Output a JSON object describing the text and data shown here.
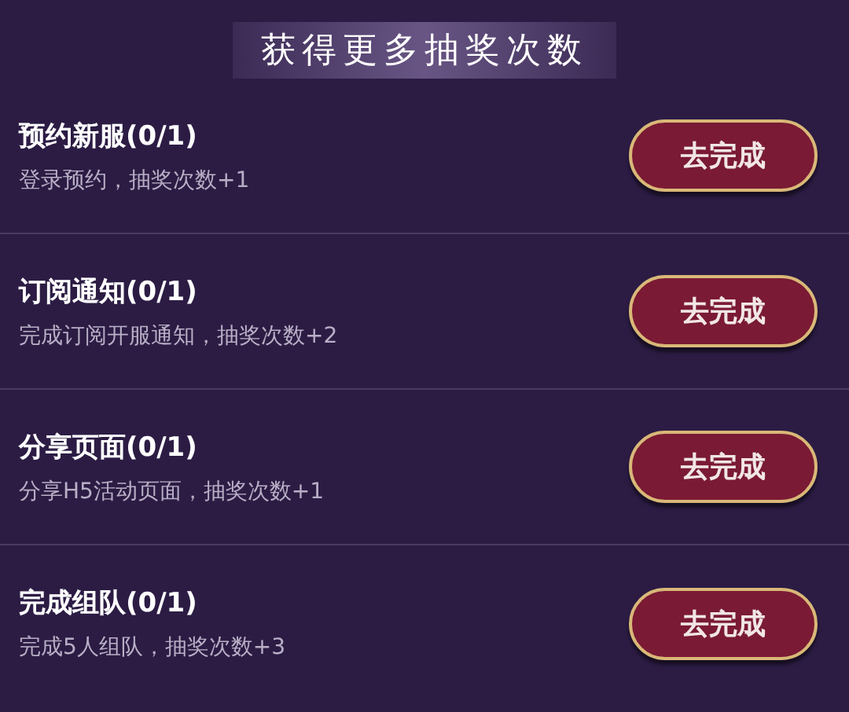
{
  "header": {
    "title": "获得更多抽奖次数"
  },
  "tasks": [
    {
      "name": "预约新服",
      "progress": "(0/1)",
      "description": "登录预约，抽奖次数+1",
      "button": "去完成"
    },
    {
      "name": "订阅通知",
      "progress": "(0/1)",
      "description": "完成订阅开服通知，抽奖次数+2",
      "button": "去完成"
    },
    {
      "name": "分享页面",
      "progress": "(0/1)",
      "description": "分享H5活动页面，抽奖次数+1",
      "button": "去完成"
    },
    {
      "name": "完成组队",
      "progress": "(0/1)",
      "description": "完成5人组队，抽奖次数+3",
      "button": "去完成"
    }
  ]
}
